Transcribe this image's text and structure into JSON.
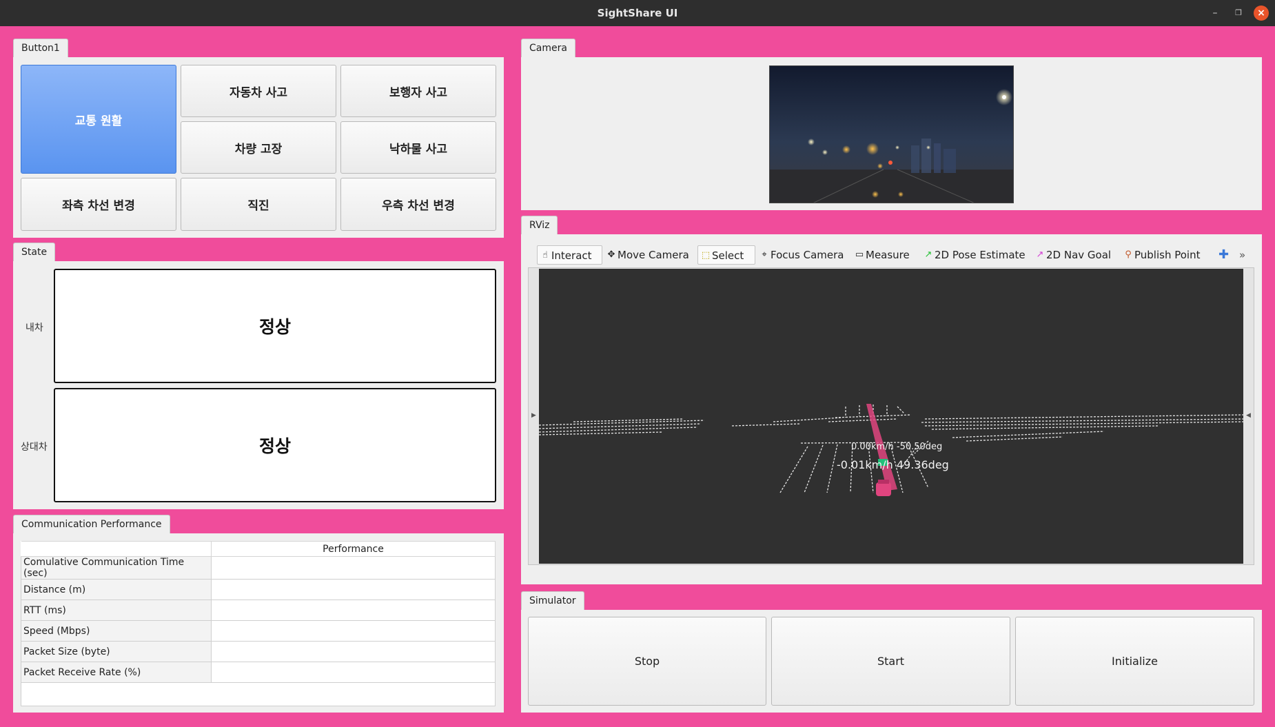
{
  "window": {
    "title": "SightShare UI"
  },
  "button_panel": {
    "tab": "Button1",
    "buttons": [
      "교통 원활",
      "자동차 사고",
      "보행자 사고",
      "차량 고장",
      "낙하물 사고",
      "좌측 차선 변경",
      "직진",
      "우측 차선 변경"
    ]
  },
  "state_panel": {
    "tab": "State",
    "rows": [
      {
        "label": "내차",
        "value": "정상"
      },
      {
        "label": "상대차",
        "value": "정상"
      }
    ]
  },
  "comm_panel": {
    "tab": "Communication Performance",
    "column_header": "Performance",
    "rows": [
      {
        "label": "Comulative Communication Time (sec)",
        "value": ""
      },
      {
        "label": "Distance (m)",
        "value": ""
      },
      {
        "label": "RTT (ms)",
        "value": ""
      },
      {
        "label": "Speed (Mbps)",
        "value": ""
      },
      {
        "label": "Packet Size (byte)",
        "value": ""
      },
      {
        "label": "Packet Receive Rate (%)",
        "value": ""
      }
    ]
  },
  "camera_panel": {
    "tab": "Camera"
  },
  "rviz_panel": {
    "tab": "RViz",
    "tools": [
      {
        "label": "Interact",
        "icon": "hand-icon"
      },
      {
        "label": "Move Camera",
        "icon": "move-camera-icon"
      },
      {
        "label": "Select",
        "icon": "select-icon"
      },
      {
        "label": "Focus Camera",
        "icon": "focus-camera-icon"
      },
      {
        "label": "Measure",
        "icon": "ruler-icon"
      },
      {
        "label": "2D Pose Estimate",
        "icon": "pose-arrow-icon"
      },
      {
        "label": "2D Nav Goal",
        "icon": "nav-goal-icon"
      },
      {
        "label": "Publish Point",
        "icon": "map-pin-icon"
      }
    ],
    "overlay_far": "0.00km/h -50.50deg",
    "overlay_near": "-0.01km/h  49.36deg"
  },
  "simulator_panel": {
    "tab": "Simulator",
    "buttons": [
      "Stop",
      "Start",
      "Initialize"
    ]
  },
  "colors": {
    "background": "#f04c9b",
    "active_button": "#5a94f0",
    "vehicle": "#e0457f"
  }
}
